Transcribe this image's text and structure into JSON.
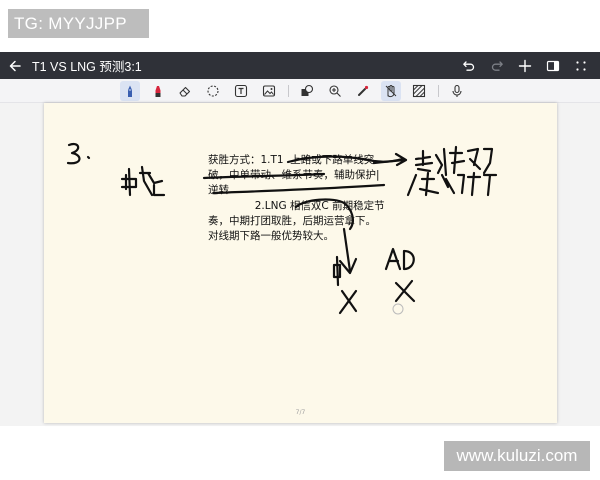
{
  "overlay": {
    "tg_label": "TG: MYYJJPP",
    "watermark": "www.kuluzi.com"
  },
  "titlebar": {
    "title": "T1 VS LNG 预测3:1",
    "icons": [
      "back-arrow-icon",
      "undo-icon",
      "redo-icon",
      "add-icon",
      "sidebar-panel-icon",
      "more-grid-icon"
    ]
  },
  "toolbar": {
    "tools": [
      "pen-icon",
      "highlighter-icon",
      "eraser-icon",
      "lasso-icon",
      "text-icon",
      "image-icon",
      "shape-icon",
      "zoom-icon",
      "laser-pointer-icon",
      "hand-icon",
      "pattern-icon",
      "microphone-icon"
    ],
    "active_tool": "pen-icon"
  },
  "note": {
    "typed_text": "获胜方式：1.T1  上路或下路单线突破，中单带动、维系节奏，辅助保护|逆转\n              2.LNG 相信双C 前期稳定节奏，中期打团取胜，后期运营拿下。对线期下路一般优势较大。",
    "page_indicator": "7/7",
    "handwriting": [
      "3.",
      "中路",
      "赛纳塔姆",
      "/关灯缩放",
      "中",
      "AD",
      "X",
      "X"
    ]
  },
  "colors": {
    "titlebar_bg": "#2f3138",
    "paper_bg": "#fdf9ea",
    "toolbar_bg": "#f4f4f6",
    "active_tool_bg": "#dbe3f3"
  }
}
